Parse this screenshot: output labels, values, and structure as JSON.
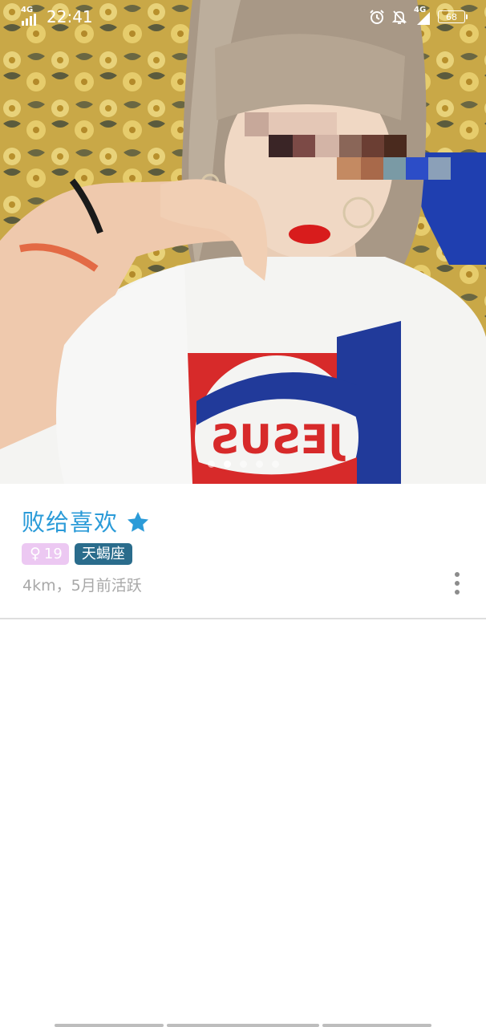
{
  "status_bar": {
    "network_left": "4G",
    "time": "22:41",
    "network_right": "4G",
    "battery": "68",
    "icons": [
      "signal-icon",
      "alarm-icon",
      "mute-bell-icon",
      "signal-icon",
      "battery-icon"
    ]
  },
  "photo": {
    "shirt_text": "JESUS",
    "carousel_total": 5,
    "carousel_active_index": 1
  },
  "profile": {
    "name": "败给喜欢",
    "gender_symbol": "♀",
    "age": "19",
    "zodiac": "天蝎座",
    "activity": "4km，5月前活跃"
  },
  "colors": {
    "name": "#2b9bd8",
    "star": "#2b9bd8",
    "gender_tag_bg": "#ecc8f2",
    "zodiac_tag_bg": "#2a6c8c",
    "activity_text": "#a8a8a8",
    "divider": "#dedede"
  }
}
